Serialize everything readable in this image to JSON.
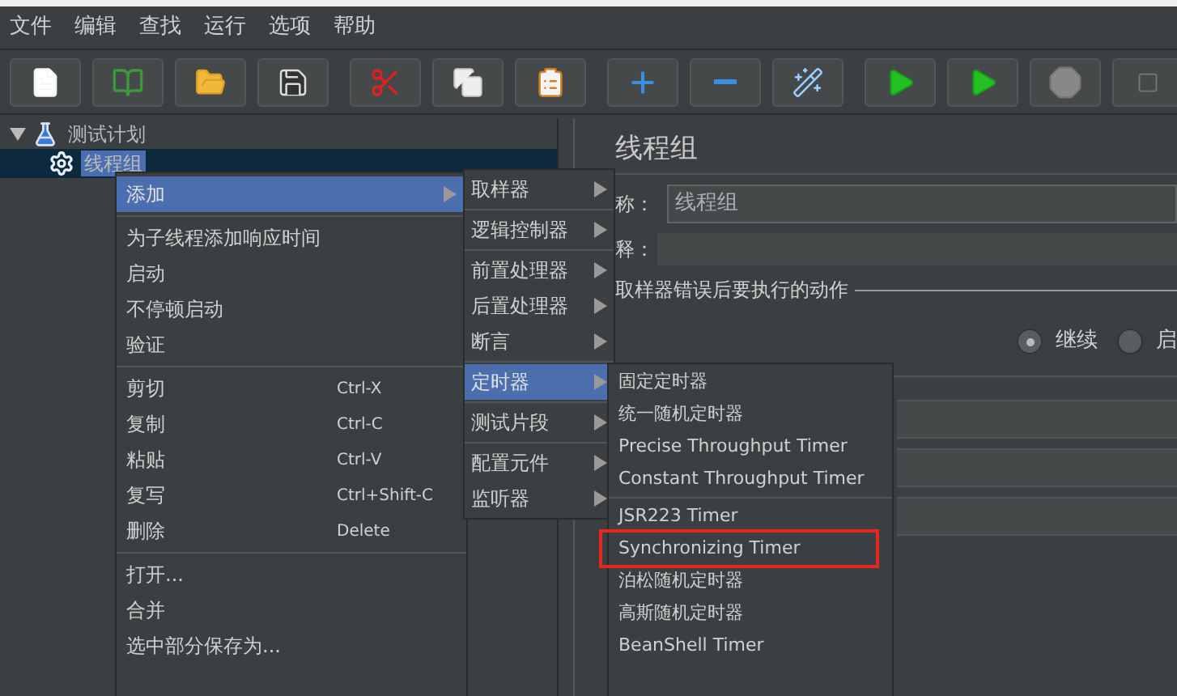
{
  "menubar": [
    "文件",
    "编辑",
    "查找",
    "运行",
    "选项",
    "帮助"
  ],
  "toolbar": [
    {
      "kind": "new"
    },
    {
      "kind": "templates"
    },
    {
      "kind": "open"
    },
    {
      "kind": "save"
    },
    {
      "kind": "cut"
    },
    {
      "kind": "copy"
    },
    {
      "kind": "paste"
    },
    {
      "kind": "expand"
    },
    {
      "kind": "collapse"
    },
    {
      "kind": "toggle"
    },
    {
      "kind": "start"
    },
    {
      "kind": "start-no-pause"
    },
    {
      "kind": "stop"
    },
    {
      "kind": "partial"
    }
  ],
  "tree": [
    {
      "label": "测试计划",
      "kind": "plan",
      "expanded": true,
      "selected": false,
      "children": [
        {
          "label": "线程组",
          "kind": "thread",
          "selected": true
        }
      ]
    }
  ],
  "panel": {
    "title": "线程组",
    "name_label": "称：",
    "name_value": "线程组",
    "comment_label": "释：",
    "section": "取样器错误后要执行的动作",
    "radios": [
      {
        "label": "继续",
        "selected": true
      },
      {
        "label": "启",
        "selected": false
      }
    ]
  },
  "context_menu": {
    "groups": [
      [
        {
          "label": "添加",
          "submenu": true,
          "selected": true
        }
      ],
      [
        {
          "label": "为子线程添加响应时间",
          "submenu": false,
          "selected": false
        },
        {
          "label": "启动",
          "submenu": false,
          "selected": false
        },
        {
          "label": "不停顿启动",
          "submenu": false,
          "selected": false
        },
        {
          "label": "验证",
          "submenu": false,
          "selected": false
        }
      ],
      [
        {
          "label": "剪切",
          "shortcut": "Ctrl-X",
          "submenu": false,
          "selected": false
        },
        {
          "label": "复制",
          "shortcut": "Ctrl-C",
          "submenu": false,
          "selected": false
        },
        {
          "label": "粘贴",
          "shortcut": "Ctrl-V",
          "submenu": false,
          "selected": false
        },
        {
          "label": "复写",
          "shortcut": "Ctrl+Shift-C",
          "submenu": false,
          "selected": false
        },
        {
          "label": "删除",
          "shortcut": "Delete",
          "submenu": false,
          "selected": false
        }
      ],
      [
        {
          "label": "打开...",
          "submenu": false,
          "selected": false
        },
        {
          "label": "合并",
          "submenu": false,
          "selected": false
        },
        {
          "label": "选中部分保存为...",
          "submenu": false,
          "selected": false
        }
      ]
    ]
  },
  "add_submenu": {
    "groups": [
      [
        {
          "label": "取样器",
          "selected": false
        }
      ],
      [
        {
          "label": "逻辑控制器",
          "selected": false
        }
      ],
      [
        {
          "label": "前置处理器",
          "selected": false
        },
        {
          "label": "后置处理器",
          "selected": false
        },
        {
          "label": "断言",
          "selected": false
        }
      ],
      [
        {
          "label": "定时器",
          "selected": true
        }
      ],
      [
        {
          "label": "测试片段",
          "selected": false
        }
      ],
      [
        {
          "label": "配置元件",
          "selected": false
        },
        {
          "label": "监听器",
          "selected": false
        }
      ]
    ]
  },
  "timer_submenu": {
    "groups": [
      [
        {
          "label": "固定定时器",
          "highlighted": false
        },
        {
          "label": "统一随机定时器",
          "highlighted": false
        },
        {
          "label": "Precise Throughput Timer",
          "highlighted": false
        },
        {
          "label": "Constant Throughput Timer",
          "highlighted": false
        }
      ],
      [
        {
          "label": "JSR223 Timer",
          "highlighted": false
        },
        {
          "label": "Synchronizing Timer",
          "highlighted": true
        },
        {
          "label": "泊松随机定时器",
          "highlighted": false
        },
        {
          "label": "高斯随机定时器",
          "highlighted": false
        },
        {
          "label": "BeanShell Timer",
          "highlighted": false
        }
      ]
    ]
  }
}
